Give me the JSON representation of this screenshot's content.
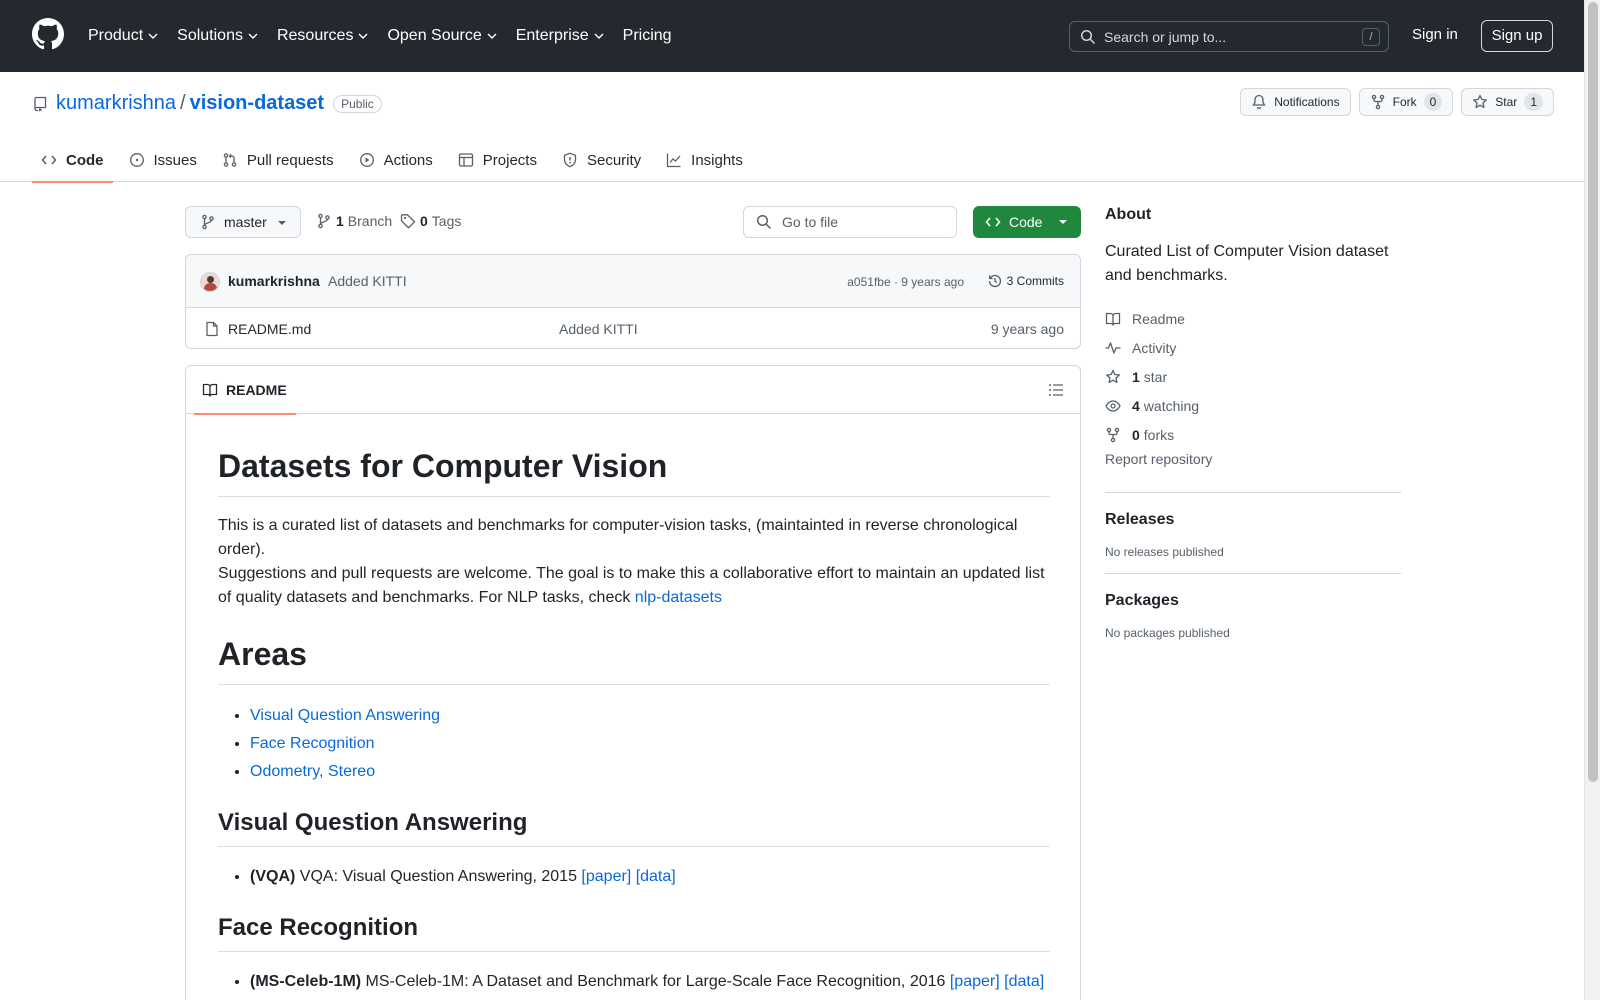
{
  "header": {
    "nav": [
      "Product",
      "Solutions",
      "Resources",
      "Open Source",
      "Enterprise",
      "Pricing"
    ],
    "search_placeholder": "Search or jump to...",
    "search_shortcut": "/",
    "sign_in": "Sign in",
    "sign_up": "Sign up"
  },
  "repo": {
    "owner": "kumarkrishna",
    "separator": "/",
    "name": "vision-dataset",
    "visibility": "Public",
    "notifications_label": "Notifications",
    "fork_label": "Fork",
    "fork_count": "0",
    "star_label": "Star",
    "star_count": "1"
  },
  "tabs": [
    "Code",
    "Issues",
    "Pull requests",
    "Actions",
    "Projects",
    "Security",
    "Insights"
  ],
  "toolbar": {
    "branch": "master",
    "branch_count": "1",
    "branch_label": "Branch",
    "tag_count": "0",
    "tag_label": "Tags",
    "goto_placeholder": "Go to file",
    "code_button": "Code"
  },
  "commit": {
    "author": "kumarkrishna",
    "message": "Added KITTI",
    "meta": "a051fbe · 9 years ago",
    "commits": "3 Commits"
  },
  "files": [
    {
      "name": "README.md",
      "message": "Added KITTI",
      "date": "9 years ago"
    }
  ],
  "readme": {
    "tab_label": "README",
    "title": "Datasets for Computer Vision",
    "intro1": "This is a curated list of datasets and benchmarks for computer-vision tasks, (maintainted in reverse chronological order).",
    "intro2_prefix": "Suggestions and pull requests are welcome. The goal is to make this a collaborative effort to maintain an updated list of quality datasets and benchmarks. For NLP tasks, check ",
    "intro2_link": "nlp-datasets",
    "areas_title": "Areas",
    "areas": [
      "Visual Question Answering",
      "Face Recognition",
      "Odometry, Stereo"
    ],
    "vqa_title": "Visual Question Answering",
    "vqa_item": {
      "tag": "(VQA)",
      "text": " VQA: Visual Question Answering, 2015 ",
      "paper": "[paper]",
      "data": "[data]"
    },
    "face_title": "Face Recognition",
    "face_item": {
      "tag": "(MS-Celeb-1M)",
      "text": " MS-Celeb-1M: A Dataset and Benchmark for Large-Scale Face Recognition, 2016 ",
      "paper": "[paper]",
      "data": "[data]"
    }
  },
  "sidebar": {
    "about_title": "About",
    "description": "Curated List of Computer Vision dataset and benchmarks.",
    "readme": "Readme",
    "activity": "Activity",
    "stars_count": "1",
    "stars_label": "star",
    "watching_count": "4",
    "watching_label": "watching",
    "forks_count": "0",
    "forks_label": "forks",
    "report": "Report repository",
    "releases_title": "Releases",
    "releases_text": "No releases published",
    "packages_title": "Packages",
    "packages_text": "No packages published"
  }
}
